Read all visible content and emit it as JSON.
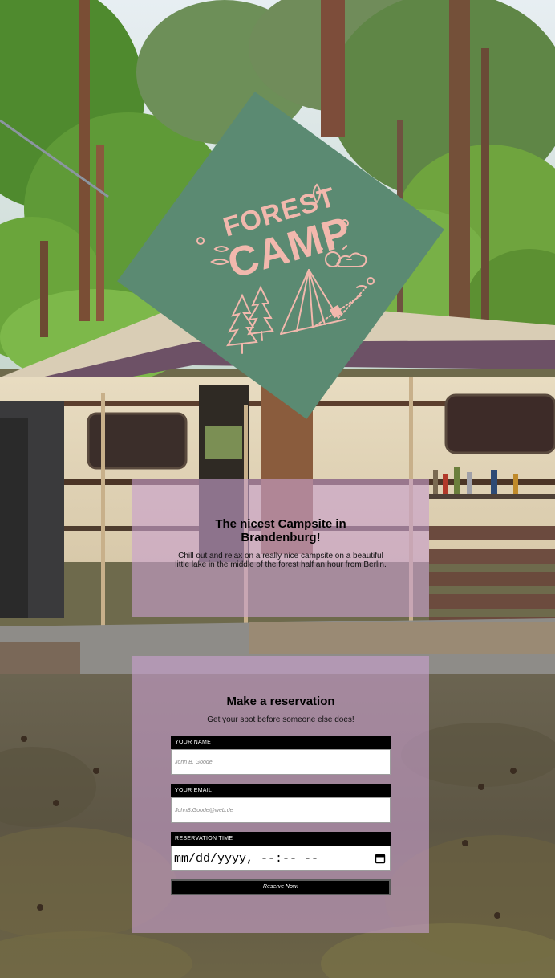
{
  "intro": {
    "title": "The nicest Campsite in Brandenburg!",
    "text": "Chill out and relax on a really nice campsite on a beautiful little lake in the middle of the forest half an hour from Berlin."
  },
  "reservation": {
    "title": "Make a reservation",
    "subtitle": "Get your spot before someone else does!",
    "name_label": "YOUR NAME",
    "name_placeholder": "John B. Goode",
    "email_label": "YOUR EMAIL",
    "email_placeholder": "JohnB.Goode@web.de",
    "time_label": "RESERVATION TIME",
    "time_value": "mm/dd/yyyy, --:-- --",
    "submit_label": "Reserve Now!"
  },
  "logo": {
    "line1": "FOREST",
    "line2": "CAMP"
  },
  "colors": {
    "logo_green": "#5b8a72",
    "logo_pink": "#f2b8ad",
    "panel_pink": "#c8a0cd",
    "label_black": "#000000"
  },
  "icons": {
    "date_picker": "calendar-icon"
  }
}
